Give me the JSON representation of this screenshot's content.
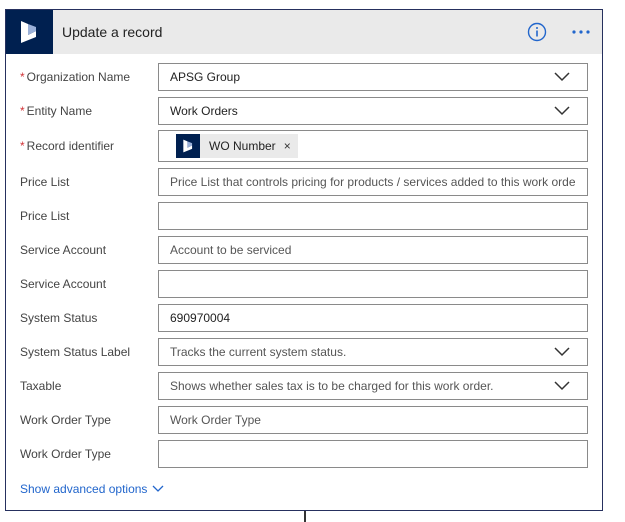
{
  "card": {
    "title": "Update a record",
    "info_icon": "info-icon",
    "more_icon": "ellipsis-icon",
    "logo_icon": "dynamics-logo-icon"
  },
  "fields": {
    "organization": {
      "label": "Organization Name",
      "required": "*",
      "value": "APSG Group"
    },
    "entity": {
      "label": "Entity Name",
      "required": "*",
      "value": "Work Orders"
    },
    "record_id": {
      "label": "Record identifier",
      "required": "*",
      "token": "WO Number",
      "token_close": "×"
    },
    "price_list_1": {
      "label": "Price List",
      "placeholder": "Price List that controls pricing for products / services added to this work order"
    },
    "price_list_2": {
      "label": "Price List",
      "value": ""
    },
    "service_account_1": {
      "label": "Service Account",
      "placeholder": "Account to be serviced"
    },
    "service_account_2": {
      "label": "Service Account",
      "value": ""
    },
    "system_status": {
      "label": "System Status",
      "value": "690970004"
    },
    "system_status_label": {
      "label": "System Status Label",
      "placeholder": "Tracks the current system status."
    },
    "taxable": {
      "label": "Taxable",
      "placeholder": "Shows whether sales tax is to be charged for this work order."
    },
    "work_order_type_1": {
      "label": "Work Order Type",
      "placeholder": "Work Order Type"
    },
    "work_order_type_2": {
      "label": "Work Order Type",
      "value": ""
    }
  },
  "advanced": {
    "label": "Show advanced options"
  },
  "colors": {
    "accent": "#2266cc",
    "brand": "#002050",
    "required": "#d13438",
    "border": "#26305e"
  }
}
